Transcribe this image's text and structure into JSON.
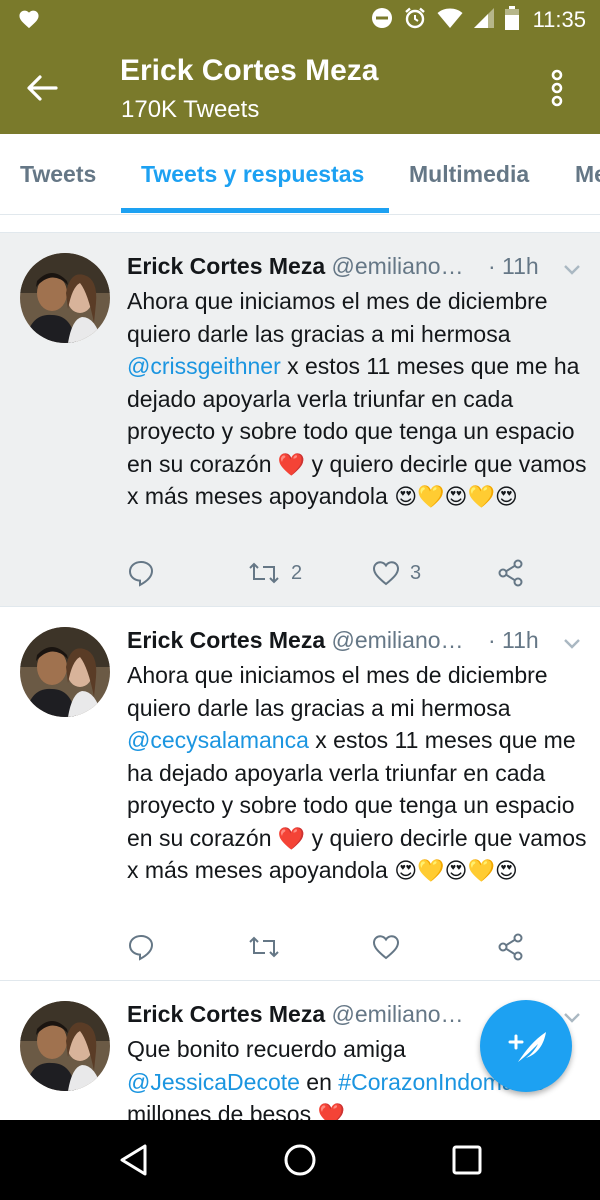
{
  "status_bar": {
    "time": "11:35",
    "icons": [
      "heart-icon",
      "do-not-disturb-icon",
      "alarm-icon",
      "wifi-icon",
      "signal-icon",
      "battery-icon"
    ],
    "background": "#7a7a2b"
  },
  "header": {
    "title": "Erick Cortes Meza",
    "subtitle": "170K Tweets"
  },
  "tabs": [
    {
      "label": "Tweets",
      "active": false
    },
    {
      "label": "Tweets y respuestas",
      "active": true
    },
    {
      "label": "Multimedia",
      "active": false
    },
    {
      "label": "Me",
      "active": false
    }
  ],
  "colors": {
    "header": "#7a7a2b",
    "accent": "#1da1f2",
    "link": "#1b95e0",
    "muted": "#657786",
    "highlight_bg": "#eef0f1"
  },
  "tweets": [
    {
      "name": "Erick Cortes Meza",
      "handle": "@emiliano…",
      "time": "· 11h",
      "text_before": "Ahora que iniciamos el mes de diciembre quiero darle las gracias a mi hermosa ",
      "mention": "@crissgeithner",
      "text_after": " x estos 11 meses que me ha dejado apoyarla verla triunfar en cada proyecto y sobre todo que tenga un espacio en su corazón ",
      "text_after2": " y quiero decirle que vamos x más meses apoyandola ",
      "heart_emoji": "❤️",
      "emoji_tail": "😍💛😍💛😍",
      "retweets": "2",
      "likes": "3"
    },
    {
      "name": "Erick Cortes Meza",
      "handle": "@emiliano…",
      "time": "· 11h",
      "text_before": "Ahora que iniciamos el mes de diciembre quiero darle las gracias a mi hermosa ",
      "mention": "@cecysalamanca",
      "text_after": " x estos 11 meses que me ha dejado apoyarla verla triunfar en cada proyecto y sobre todo que tenga un espacio en su corazón ",
      "text_after2": " y quiero decirle que vamos x más meses apoyandola ",
      "heart_emoji": "❤️",
      "emoji_tail": "😍💛😍💛😍",
      "retweets": "",
      "likes": ""
    },
    {
      "name": "Erick Cortes Meza",
      "handle": "@emiliano…",
      "text_line1": "Que bonito recuerdo amiga",
      "mention": "@JessicaDecote",
      "text_mid": " en ",
      "hashtag": "#CorazonIndomable",
      "text_line3": "millones de besos ",
      "heart_emoji": "❤️"
    }
  ]
}
